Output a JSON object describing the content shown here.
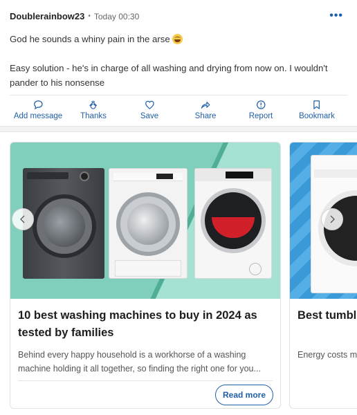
{
  "post": {
    "author": "Doublerainbow23",
    "separator": "•",
    "time": "Today 00:30",
    "paragraph1": "God he sounds a whiny pain in the arse",
    "paragraph2": "Easy solution - he's in charge of all washing and drying from now on. I wouldn't pander to his nonsense",
    "actions": [
      {
        "label": "Add message",
        "icon": "speech-bubble-icon"
      },
      {
        "label": "Thanks",
        "icon": "thanks-hands-icon"
      },
      {
        "label": "Save",
        "icon": "heart-icon"
      },
      {
        "label": "Share",
        "icon": "share-arrow-icon"
      },
      {
        "label": "Report",
        "icon": "alert-circle-icon"
      },
      {
        "label": "Bookmark",
        "icon": "bookmark-icon"
      }
    ]
  },
  "carousel": {
    "cards": [
      {
        "title": "10 best washing machines to buy in 2024 as tested by families",
        "description": "Behind every happy household is a workhorse of a washing machine holding it all together, so finding the right one for you...",
        "button": "Read more"
      },
      {
        "title": "Best tumbl condenser",
        "description": "Energy costs m remain the mo"
      }
    ]
  },
  "colors": {
    "accent": "#1f5fa8",
    "card1_background": "#7fcfbc",
    "card2_background": "#3a9ad8"
  }
}
